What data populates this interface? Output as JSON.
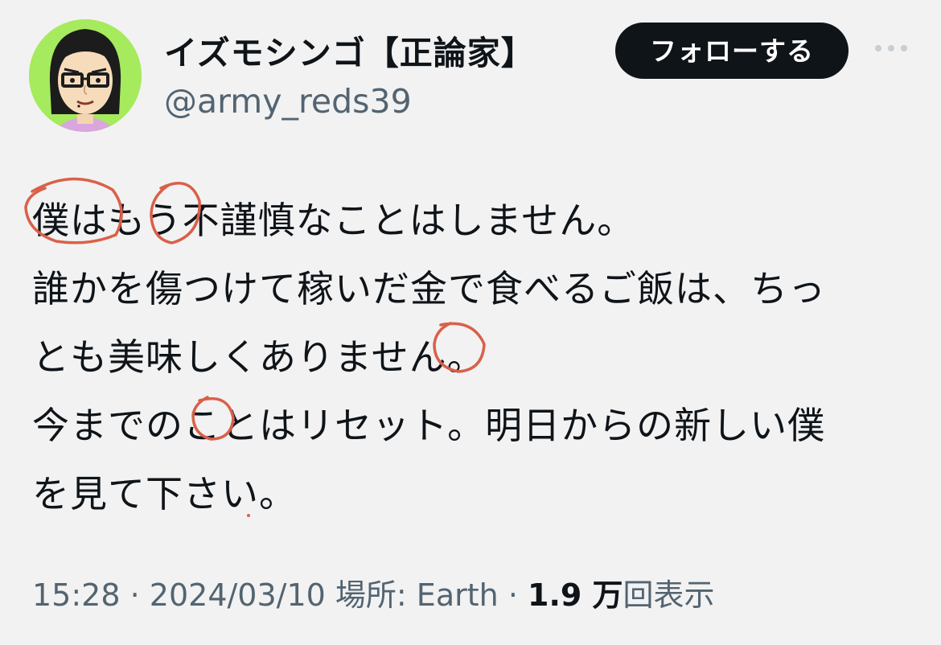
{
  "profile": {
    "display_name": "イズモシンゴ【正論家】",
    "handle": "@army_reds39",
    "avatar_icon": "mii-avatar-icon",
    "avatar_bg": "#a6ea5e"
  },
  "actions": {
    "follow_label": "フォローする",
    "more_icon": "more-horizontal-icon"
  },
  "tweet": {
    "lines": [
      "僕はもう不謹慎なことはしません。",
      "誰かを傷つけて稼いだ金で食べるご飯は、ちっ",
      "とも美味しくありません。",
      "今までのことはリセット。明日からの新しい僕",
      "を見て下さい。"
    ],
    "annotation_color": "#d9604a"
  },
  "meta": {
    "time": "15:28",
    "separator": "·",
    "date": "2024/03/10",
    "location_label": "場所: Earth",
    "views_count": "1.9 万",
    "views_label": "回表示"
  }
}
